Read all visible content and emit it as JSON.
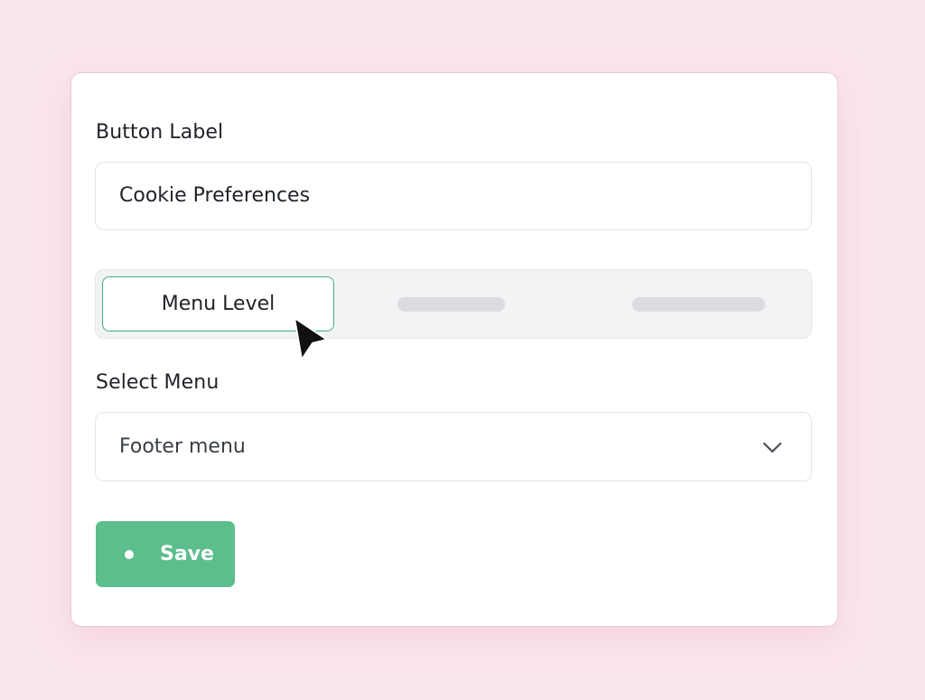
{
  "form": {
    "button_label": {
      "label": "Button Label",
      "value": "Cookie Preferences"
    },
    "tabs": [
      {
        "label": "Menu Level",
        "active": true
      },
      {
        "label": "",
        "active": false
      },
      {
        "label": "",
        "active": false
      }
    ],
    "select_menu": {
      "label": "Select Menu",
      "value": "Footer menu",
      "icon": "chevron-down-icon"
    },
    "save": {
      "label": "Save",
      "icon": "dot-icon"
    }
  },
  "colors": {
    "background": "#fce6ee",
    "accent": "#5cbd8d",
    "active_tab_border": "#3fae7c"
  },
  "cursor": {
    "icon": "mouse-pointer-icon"
  }
}
